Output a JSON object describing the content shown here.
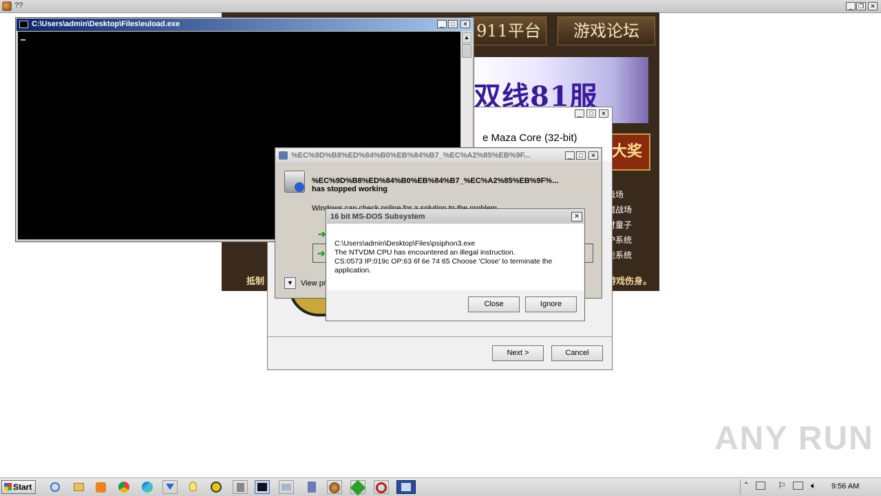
{
  "topbar": {
    "title": "??"
  },
  "banner": {
    "tabs": [
      "911平台",
      "游戏论坛"
    ],
    "promo_text": "双线81服",
    "prize_text": "大奖",
    "side_items": [
      "级场",
      "魔战场",
      "财童子",
      "炉系统",
      "能系统"
    ],
    "bottom_left": "抵制",
    "bottom_right": "游戏伤身。"
  },
  "console": {
    "title": "C:\\Users\\admin\\Desktop\\Files\\euload.exe"
  },
  "installer": {
    "heading": "e Maza Core (32-bit)",
    "next_label": "Next >",
    "cancel_label": "Cancel"
  },
  "werr": {
    "title": "%EC%9D%B8%ED%84%B0%EB%84%B7_%EC%A2%85%EB%9F...",
    "heading_line1": "%EC%9D%B8%ED%84%B0%EB%84%B7_%EC%A2%85%EB%9F%...",
    "heading_line2": "has stopped working",
    "sub": "Windows can check online for a solution to the problem.",
    "view_label": "View pr"
  },
  "ntvdm": {
    "title": "16 bit MS-DOS Subsystem",
    "line1": "C:\\Users\\admin\\Desktop\\Files\\psiphon3.exe",
    "line2": "The NTVDM CPU has encountered an illegal instruction.",
    "line3": "CS:0573 IP:019c OP:63 6f 6e 74 65 Choose 'Close' to terminate the application.",
    "close_label": "Close",
    "ignore_label": "Ignore"
  },
  "taskbar": {
    "start_label": "Start",
    "clock": "9:56 AM",
    "icons": [
      "ie-icon",
      "explorer-icon",
      "media-player-icon",
      "chrome-icon",
      "edge-icon",
      "download-icon",
      "bulb-icon",
      "norton-icon",
      "calc-icon",
      "console-task-icon",
      "window-task-icon",
      "installer-task-icon",
      "game-task-icon",
      "green-task-icon",
      "opera-task-icon",
      "error-task-icon"
    ]
  },
  "watermark": "ANY RUN"
}
